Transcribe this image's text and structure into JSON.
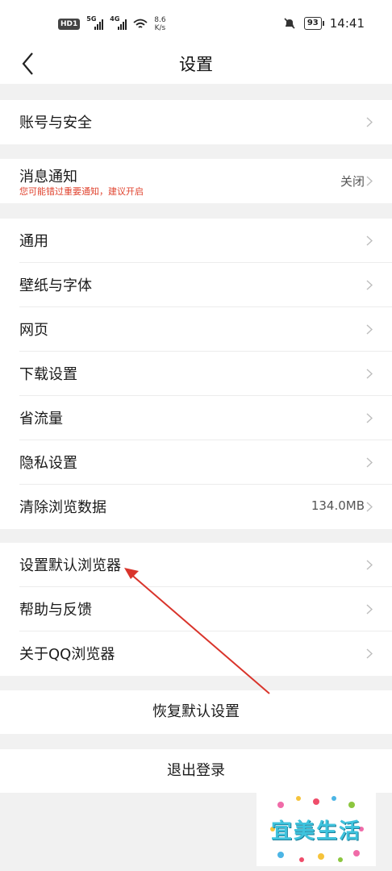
{
  "status_bar": {
    "hd_badge": "HD1",
    "net1": "5G",
    "net2": "4G",
    "speed_value": "8.6",
    "speed_unit": "K/s",
    "battery": "93",
    "time": "14:41"
  },
  "header": {
    "title": "设置"
  },
  "groups": {
    "account": {
      "label": "账号与安全"
    },
    "notification": {
      "label": "消息通知",
      "sub": "您可能错过重要通知，建议开启",
      "value": "关闭"
    },
    "general": {
      "items": [
        {
          "label": "通用",
          "value": ""
        },
        {
          "label": "壁纸与字体",
          "value": ""
        },
        {
          "label": "网页",
          "value": ""
        },
        {
          "label": "下载设置",
          "value": ""
        },
        {
          "label": "省流量",
          "value": ""
        },
        {
          "label": "隐私设置",
          "value": ""
        },
        {
          "label": "清除浏览数据",
          "value": "134.0MB"
        }
      ]
    },
    "misc": {
      "items": [
        {
          "label": "设置默认浏览器"
        },
        {
          "label": "帮助与反馈"
        },
        {
          "label": "关于QQ浏览器"
        }
      ]
    }
  },
  "actions": {
    "restore": "恢复默认设置",
    "logout": "退出登录"
  },
  "watermark": {
    "text": "宜美生活"
  },
  "colors": {
    "accent_red": "#e0432f",
    "arrow_red": "#d9342b",
    "background": "#f1f1f1"
  }
}
